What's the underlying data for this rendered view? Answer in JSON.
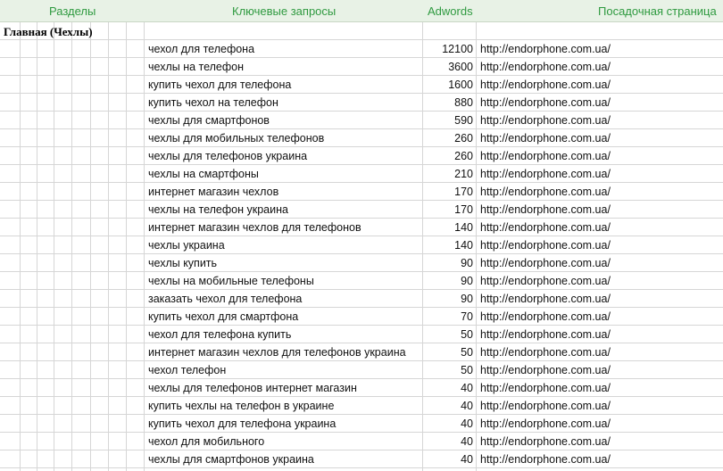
{
  "headers": {
    "sections": "Разделы",
    "keywords": "Ключевые запросы",
    "adwords": "Adwords",
    "landing": "Посадочная страница"
  },
  "section_title": "Главная (Чехлы)",
  "rows": [
    {
      "query": "чехол для телефона",
      "volume": "12100",
      "url": "http://endorphone.com.ua/"
    },
    {
      "query": "чехлы на телефон",
      "volume": "3600",
      "url": "http://endorphone.com.ua/"
    },
    {
      "query": "купить чехол для телефона",
      "volume": "1600",
      "url": "http://endorphone.com.ua/"
    },
    {
      "query": "купить чехол на телефон",
      "volume": "880",
      "url": "http://endorphone.com.ua/"
    },
    {
      "query": "чехлы для смартфонов",
      "volume": "590",
      "url": "http://endorphone.com.ua/"
    },
    {
      "query": "чехлы для мобильных телефонов",
      "volume": "260",
      "url": "http://endorphone.com.ua/"
    },
    {
      "query": "чехлы для телефонов украина",
      "volume": "260",
      "url": "http://endorphone.com.ua/"
    },
    {
      "query": "чехлы на смартфоны",
      "volume": "210",
      "url": "http://endorphone.com.ua/"
    },
    {
      "query": "интернет магазин чехлов",
      "volume": "170",
      "url": "http://endorphone.com.ua/"
    },
    {
      "query": "чехлы на телефон украина",
      "volume": "170",
      "url": "http://endorphone.com.ua/"
    },
    {
      "query": "интернет магазин чехлов для телефонов",
      "volume": "140",
      "url": "http://endorphone.com.ua/"
    },
    {
      "query": "чехлы украина",
      "volume": "140",
      "url": "http://endorphone.com.ua/"
    },
    {
      "query": "чехлы купить",
      "volume": "90",
      "url": "http://endorphone.com.ua/"
    },
    {
      "query": "чехлы на мобильные телефоны",
      "volume": "90",
      "url": "http://endorphone.com.ua/"
    },
    {
      "query": "заказать чехол для телефона",
      "volume": "90",
      "url": "http://endorphone.com.ua/"
    },
    {
      "query": "купить чехол для смартфона",
      "volume": "70",
      "url": "http://endorphone.com.ua/"
    },
    {
      "query": "чехол для телефона купить",
      "volume": "50",
      "url": "http://endorphone.com.ua/"
    },
    {
      "query": "интернет магазин чехлов для телефонов украина",
      "volume": "50",
      "url": "http://endorphone.com.ua/"
    },
    {
      "query": "чехол телефон",
      "volume": "50",
      "url": "http://endorphone.com.ua/"
    },
    {
      "query": "чехлы для телефонов интернет магазин",
      "volume": "40",
      "url": "http://endorphone.com.ua/"
    },
    {
      "query": "купить чехлы на телефон в украине",
      "volume": "40",
      "url": "http://endorphone.com.ua/"
    },
    {
      "query": "купить чехол для телефона украина",
      "volume": "40",
      "url": "http://endorphone.com.ua/"
    },
    {
      "query": "чехол для мобильного",
      "volume": "40",
      "url": "http://endorphone.com.ua/"
    },
    {
      "query": "чехлы для смартфонов украина",
      "volume": "40",
      "url": "http://endorphone.com.ua/"
    }
  ]
}
